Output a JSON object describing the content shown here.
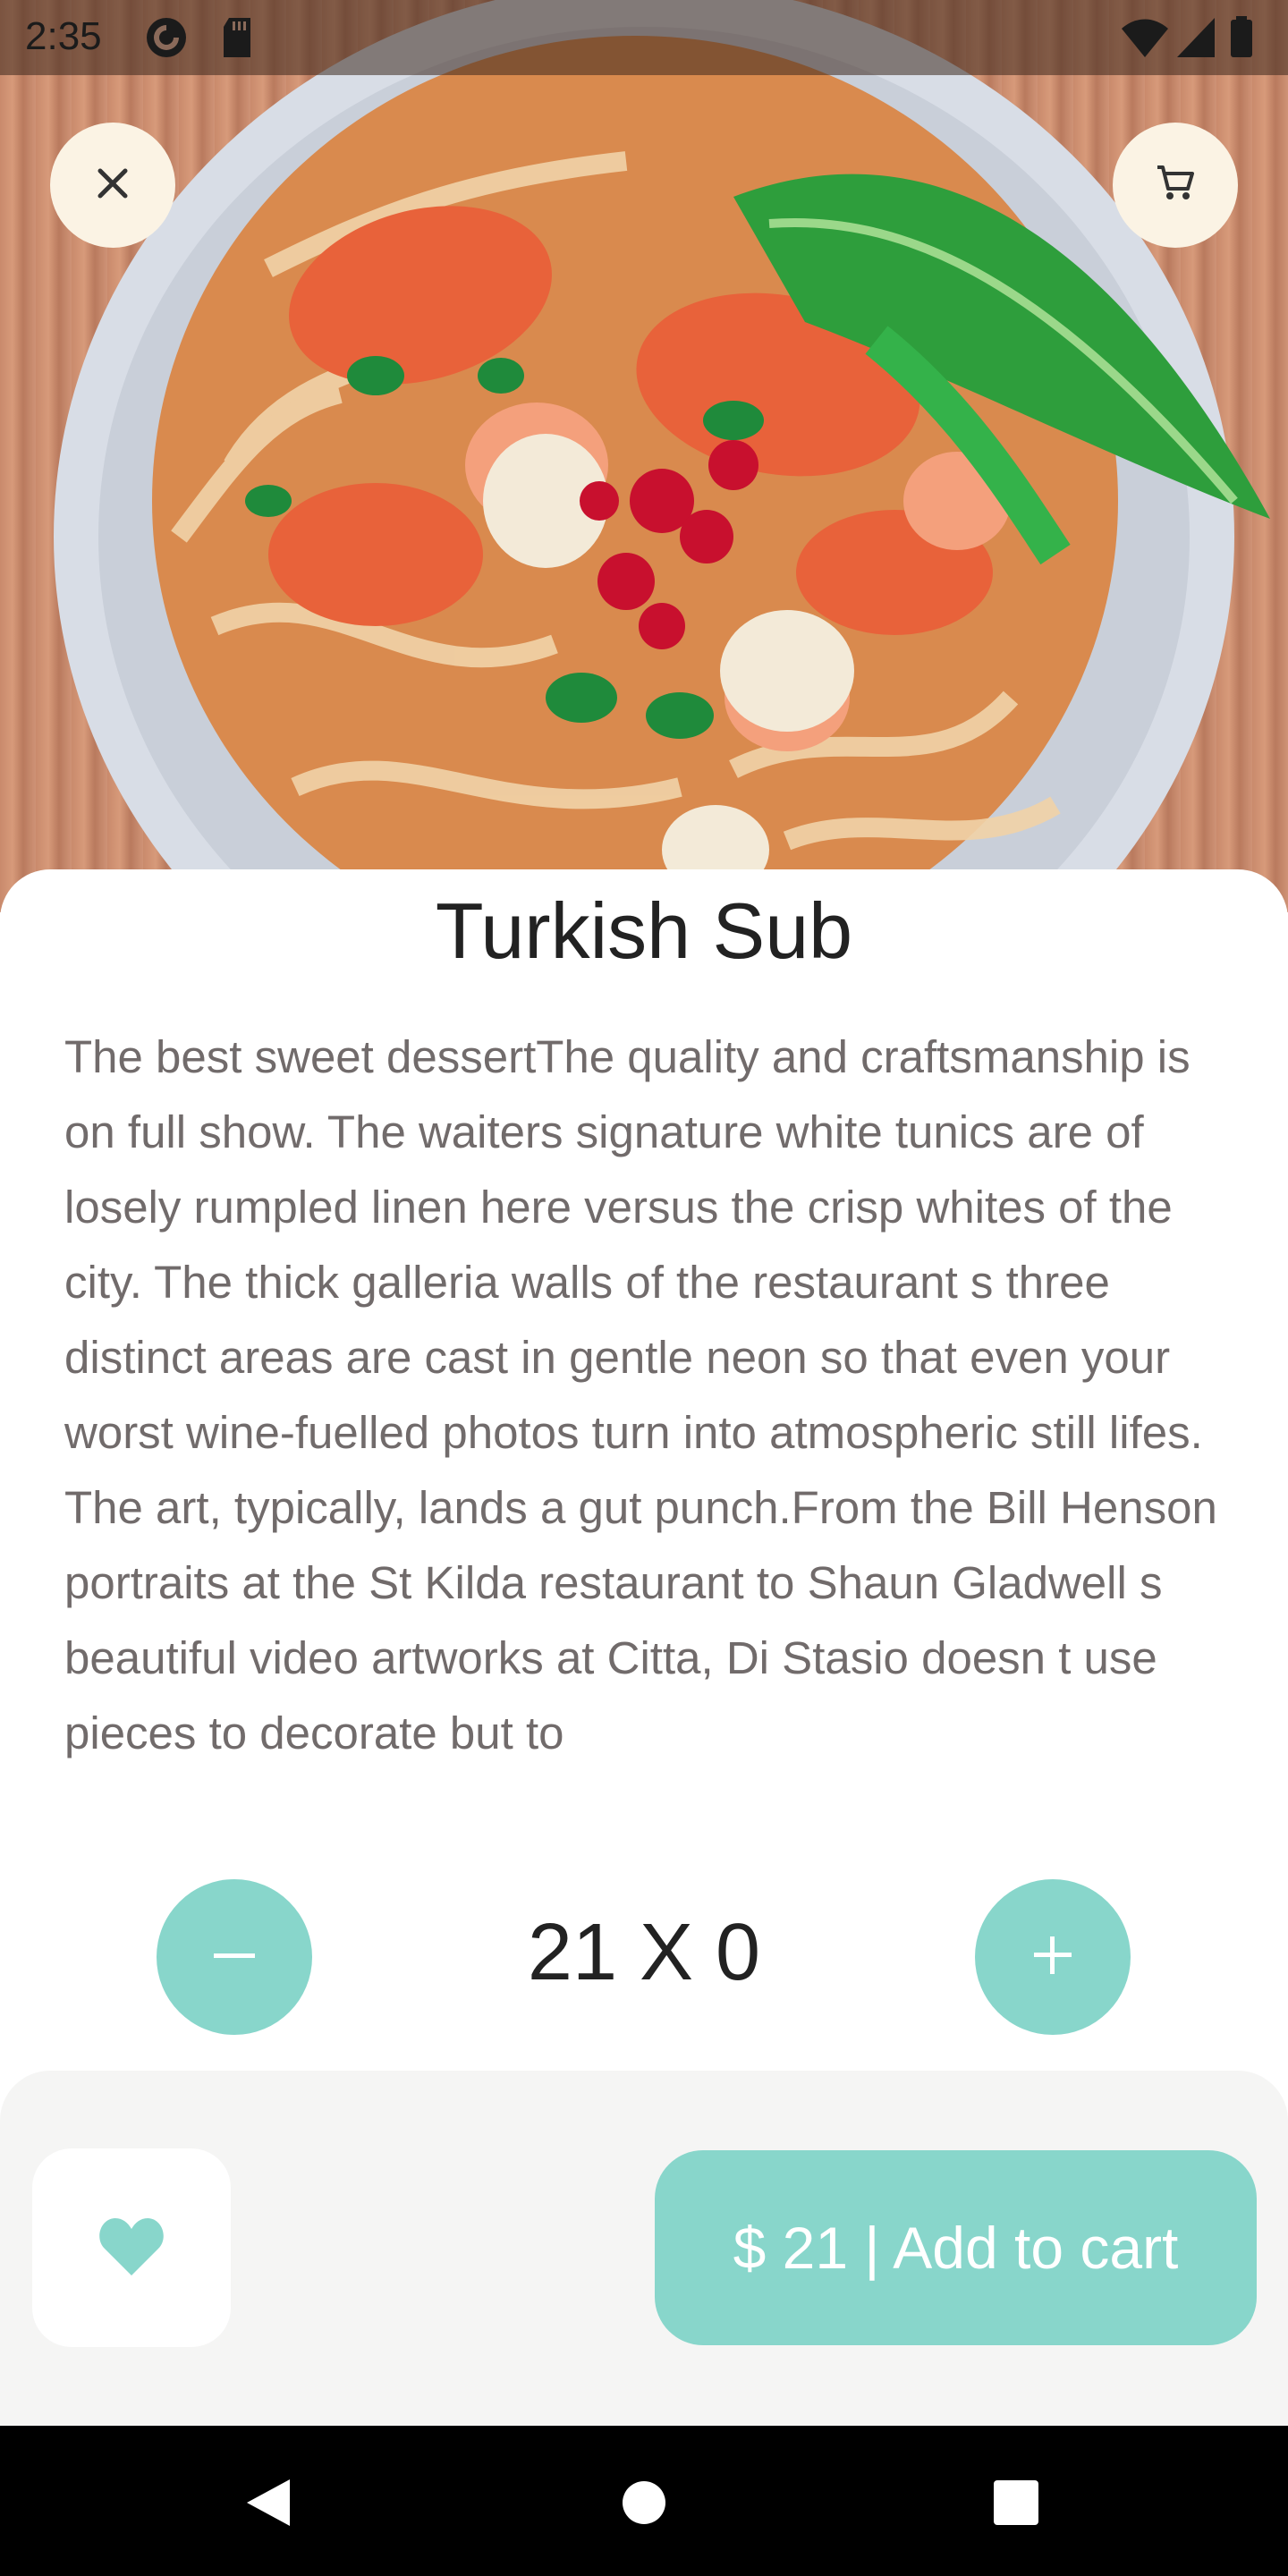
{
  "status_bar": {
    "time": "2:35",
    "icons": [
      "pocket-casts-icon",
      "sd-card-icon",
      "wifi-icon",
      "cellular-signal-icon",
      "battery-icon"
    ]
  },
  "header": {
    "close_icon": "close-icon",
    "cart_icon": "shopping-cart-icon"
  },
  "product": {
    "name": "Turkish Sub",
    "description": "The best sweet dessertThe quality and craftsmanship is on full show. The waiters signature white tunics are of losely rumpled linen here versus the crisp whites of the city. The thick galleria walls of the restaurant s three distinct areas are cast in gentle neon so that even your worst wine-fuelled photos turn into atmospheric still lifes. The art, typically, lands a gut punch.From the Bill Henson portraits at the St Kilda restaurant to Shaun Gladwell s beautiful video artworks at Citta, Di Stasio doesn t use pieces to decorate but to"
  },
  "quantity": {
    "text": "21 X 0",
    "minus_icon": "minus-icon",
    "plus_icon": "plus-icon"
  },
  "footer": {
    "favorite_icon": "heart-icon",
    "add_to_cart_label": "$ 21 | Add to cart"
  },
  "colors": {
    "accent": "#88d6cb",
    "fab_background": "#fbf3e4",
    "text_dark": "#222222",
    "text_body": "#716b6b",
    "bottom_bar": "#f5f5f4"
  },
  "nav_bar": [
    "back-icon",
    "home-icon",
    "recents-icon"
  ]
}
